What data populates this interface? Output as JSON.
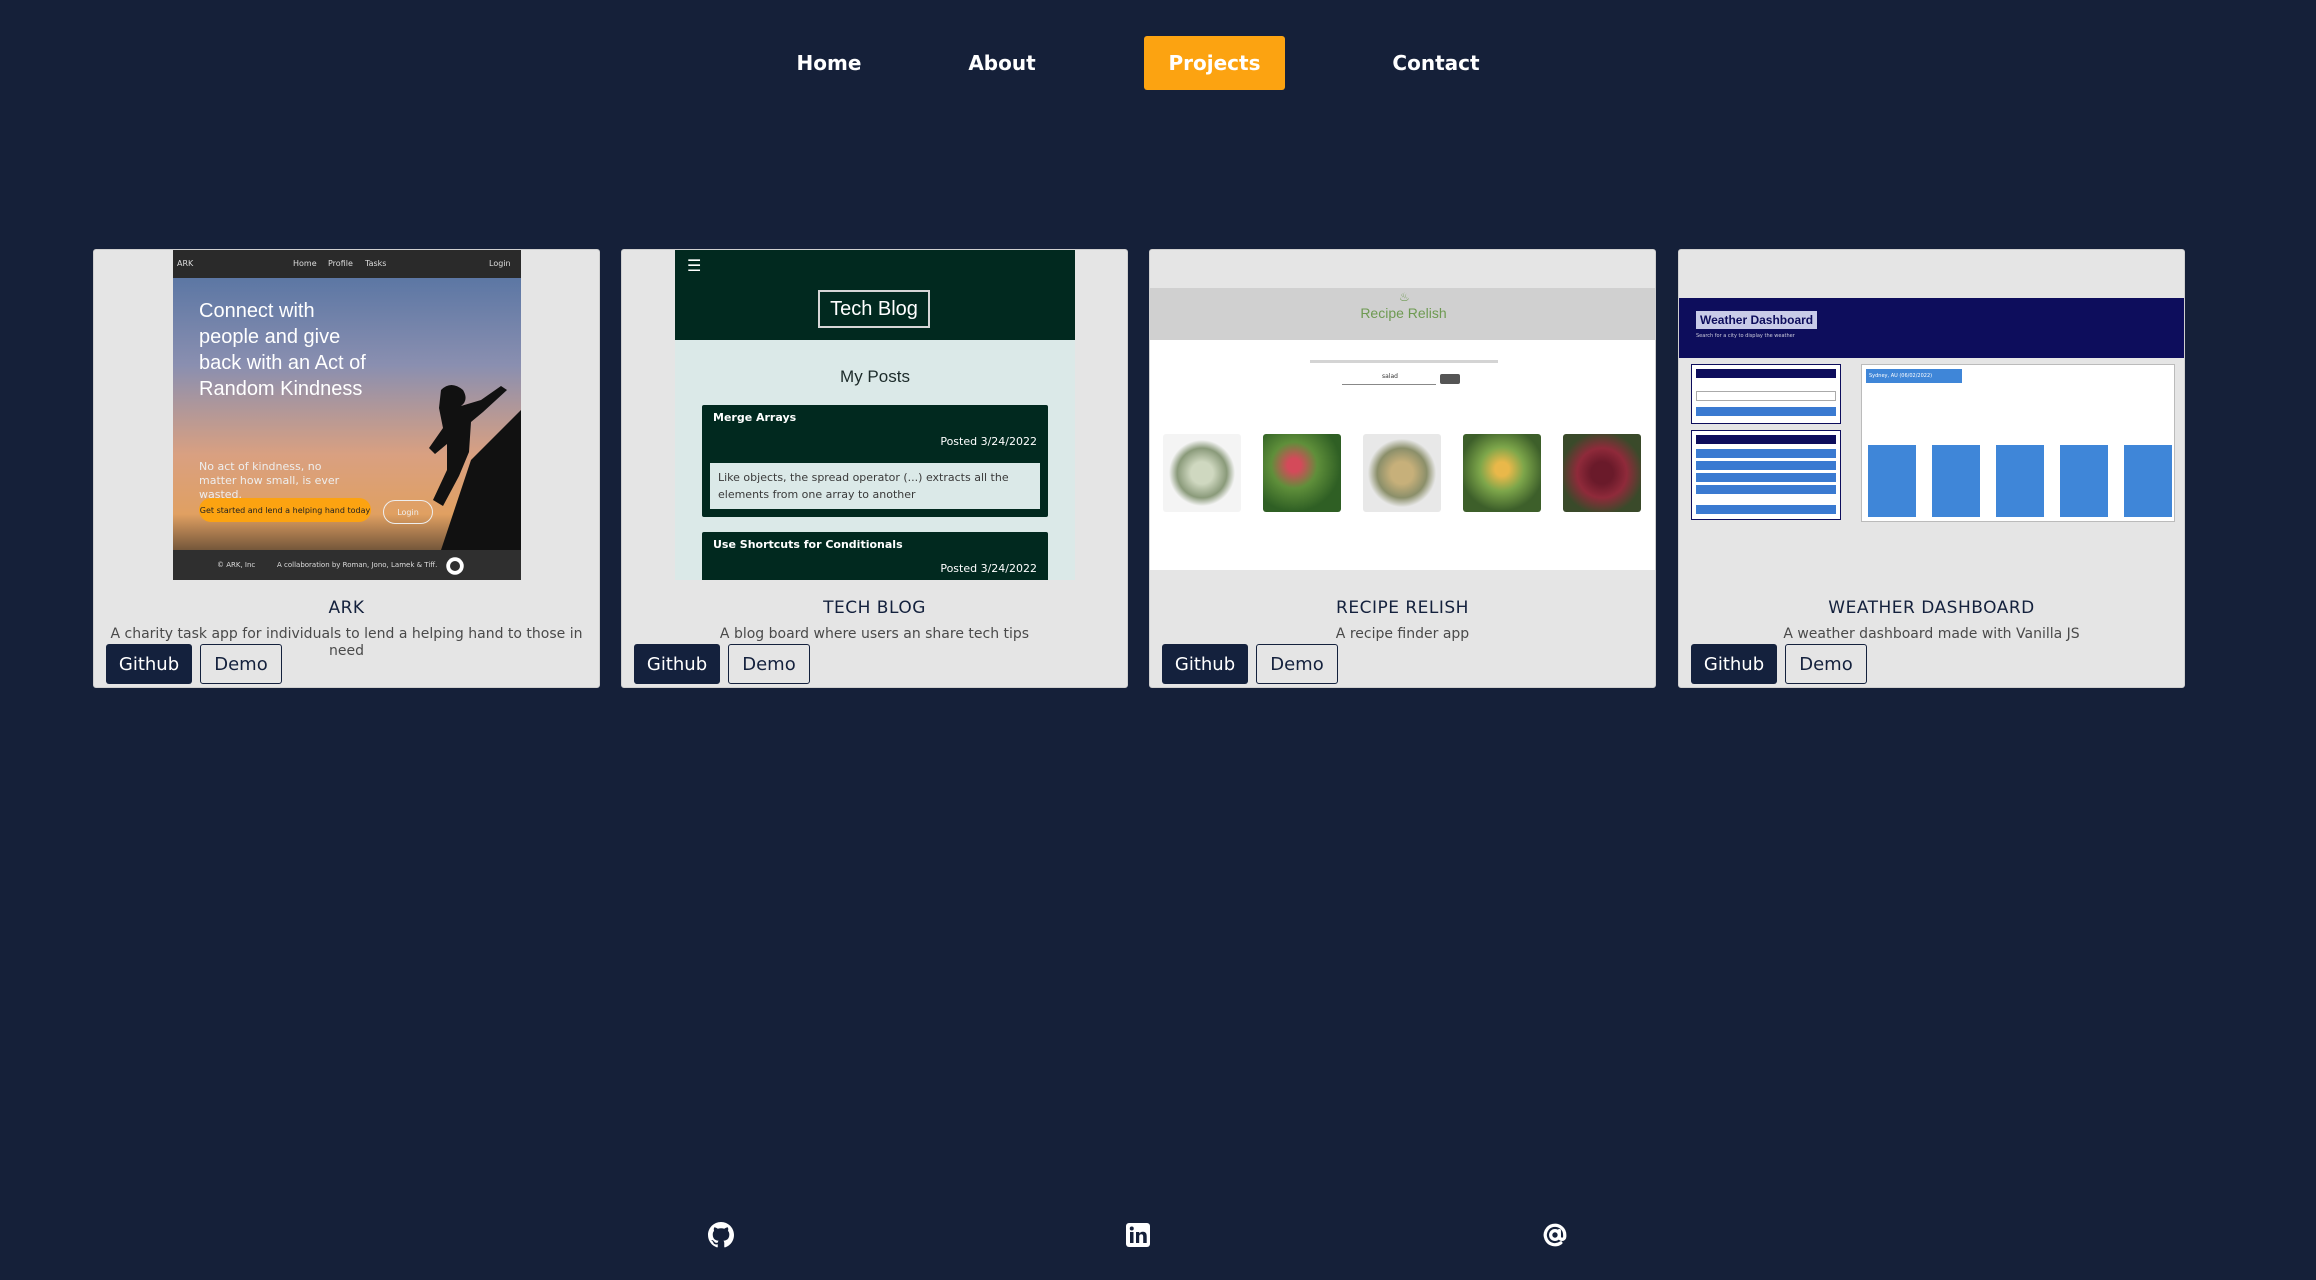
{
  "nav": {
    "items": [
      {
        "label": "Home",
        "active": false
      },
      {
        "label": "About",
        "active": false
      },
      {
        "label": "Projects",
        "active": true
      },
      {
        "label": "Contact",
        "active": false
      }
    ]
  },
  "projects": [
    {
      "title": "ARK",
      "description": "A charity task app for individuals to lend a helping hand to those in need",
      "github_label": "Github",
      "demo_label": "Demo",
      "screenshot": {
        "brand": "ARK",
        "nav_links": [
          "Home",
          "Profile",
          "Tasks"
        ],
        "login": "Login",
        "headline": "Connect with people and give back with an Act of Random Kindness",
        "subtext": "No act of kindness, no matter how small, is ever wasted.",
        "cta": "Get started and lend a helping hand today",
        "login_button": "Login",
        "footer_left": "© ARK, Inc",
        "footer_right": "A collaboration by Roman, Jono, Lamek & Tiff."
      }
    },
    {
      "title": "TECH BLOG",
      "description": "A blog board where users an share tech tips",
      "github_label": "Github",
      "demo_label": "Demo",
      "screenshot": {
        "logo": "Tech Blog",
        "heading": "My Posts",
        "posts": [
          {
            "title": "Merge Arrays",
            "date": "Posted 3/24/2022",
            "body": "Like objects, the spread operator (...) extracts all the elements from one array to another"
          },
          {
            "title": "Use Shortcuts for Conditionals",
            "date": "Posted 3/24/2022",
            "body": ""
          }
        ]
      }
    },
    {
      "title": "RECIPE RELISH",
      "description": "A recipe finder app",
      "github_label": "Github",
      "demo_label": "Demo",
      "screenshot": {
        "logo": "Recipe Relish",
        "search_placeholder": "salad"
      }
    },
    {
      "title": "WEATHER DASHBOARD",
      "description": "A weather dashboard made with Vanilla JS",
      "github_label": "Github",
      "demo_label": "Demo",
      "screenshot": {
        "title": "Weather Dashboard",
        "subtitle": "Search for a city to display the weather",
        "current_city": "Sydney, AU (06/02/2022)"
      }
    }
  ],
  "footer": {
    "icons": [
      "github-icon",
      "linkedin-icon",
      "email-at-icon"
    ]
  },
  "colors": {
    "background": "#152039",
    "accent": "#fca311",
    "card": "#e5e5e5",
    "button_dark": "#14213d"
  }
}
